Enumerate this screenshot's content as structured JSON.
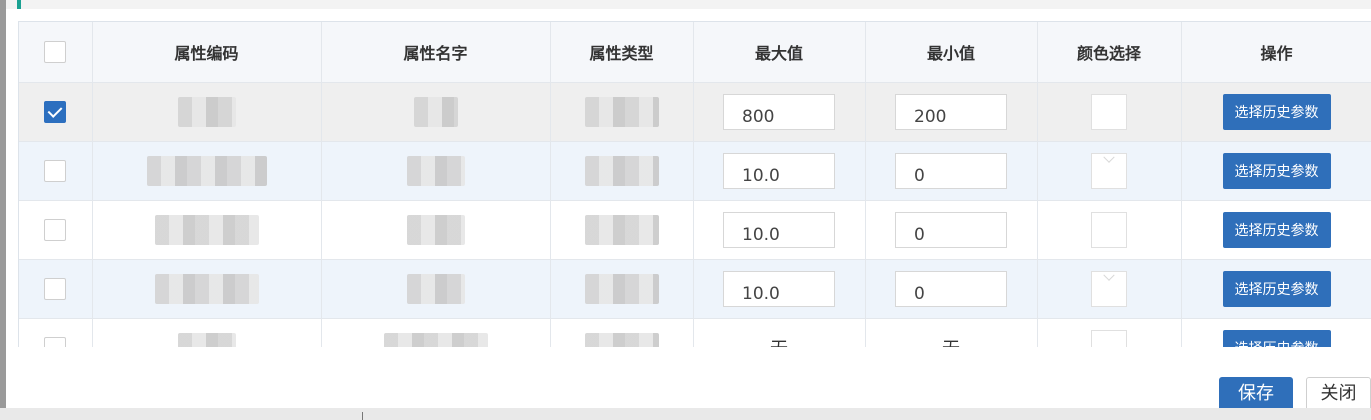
{
  "table": {
    "headers": [
      "属性编码",
      "属性名字",
      "属性类型",
      "最大值",
      "最小值",
      "颜色选择",
      "操作"
    ],
    "rows": [
      {
        "checked": true,
        "max": "800",
        "min": "200",
        "color": "red",
        "action": "选择历史参数"
      },
      {
        "checked": false,
        "max": "10.0",
        "min": "0",
        "color": "empty",
        "action": "选择历史参数"
      },
      {
        "checked": false,
        "max": "10.0",
        "min": "0",
        "color": "empty",
        "action": "选择历史参数"
      },
      {
        "checked": false,
        "max": "10.0",
        "min": "0",
        "color": "empty",
        "action": "选择历史参数"
      },
      {
        "checked": false,
        "max": "无",
        "min": "无",
        "color": "empty",
        "action": "选择历史参数"
      }
    ]
  },
  "footer": {
    "save_label": "保存",
    "close_label": "关闭"
  },
  "colors": {
    "accent": "#2f6fba",
    "selected_color": "#d0383c",
    "tab_accent": "#1aa192"
  }
}
